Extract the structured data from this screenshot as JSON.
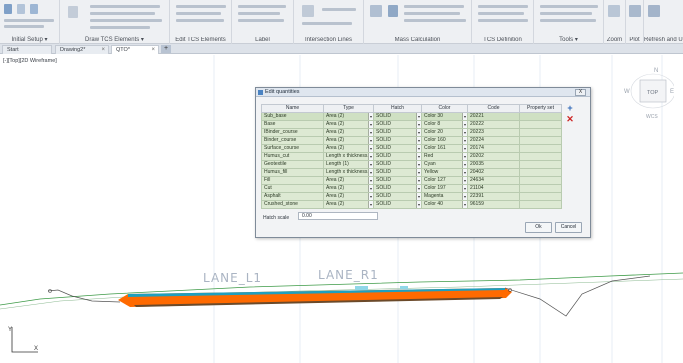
{
  "ribbon": {
    "groups": [
      {
        "title": "Initial Setup ▾"
      },
      {
        "title": "Draw TCS Elements ▾"
      },
      {
        "title": "Edit TCS Elements"
      },
      {
        "title": "Label"
      },
      {
        "title": "Intersection Lines"
      },
      {
        "title": "Mass Calculation"
      },
      {
        "title": "TCS Definition"
      },
      {
        "title": "Tools ▾"
      },
      {
        "title": "Zoom"
      },
      {
        "title": "Plot"
      },
      {
        "title": "Refresh and Undo"
      }
    ]
  },
  "tabs": [
    {
      "label": "Start"
    },
    {
      "label": "Drawing2*"
    },
    {
      "label": "QTO*"
    }
  ],
  "canvas": {
    "view_label": "[-][Top][2D Wireframe]",
    "viewcube": {
      "top": "TOP",
      "north": "N",
      "west": "W",
      "east": "E",
      "wcs": "WCS"
    },
    "lane_left": "LANE_L1",
    "lane_right": "LANE_R1",
    "ucs_y": "Y",
    "ucs_x": "X"
  },
  "dialog": {
    "title": "Edit quantities",
    "close": "X",
    "columns": [
      "Name",
      "Type",
      "Hatch",
      "Color",
      "Code",
      "Property set"
    ],
    "rows": [
      {
        "name": "Sub_base",
        "type": "Area (2)",
        "hatch": "SOLID",
        "color": "Color 30",
        "code": "20221",
        "pset": ""
      },
      {
        "name": "Base",
        "type": "Area (2)",
        "hatch": "SOLID",
        "color": "Color 8",
        "code": "20222",
        "pset": ""
      },
      {
        "name": "IBinder_course",
        "type": "Area (2)",
        "hatch": "SOLID",
        "color": "Color 20",
        "code": "20223",
        "pset": ""
      },
      {
        "name": "Binder_course",
        "type": "Area (2)",
        "hatch": "SOLID",
        "color": "Color 160",
        "code": "20224",
        "pset": ""
      },
      {
        "name": "Surface_course",
        "type": "Area (2)",
        "hatch": "SOLID",
        "color": "Color 161",
        "code": "20174",
        "pset": ""
      },
      {
        "name": "Humus_cut",
        "type": "Length x thickness...",
        "hatch": "SOLID",
        "color": "Red",
        "code": "20202",
        "pset": ""
      },
      {
        "name": "Geotextile",
        "type": "Length (1)",
        "hatch": "SOLID",
        "color": "Cyan",
        "code": "20035",
        "pset": ""
      },
      {
        "name": "Humus_fill",
        "type": "Length x thickness...",
        "hatch": "SOLID",
        "color": "Yellow",
        "code": "20402",
        "pset": ""
      },
      {
        "name": "Fill",
        "type": "Area (2)",
        "hatch": "SOLID",
        "color": "Color 127",
        "code": "24634",
        "pset": ""
      },
      {
        "name": "Cut",
        "type": "Area (2)",
        "hatch": "SOLID",
        "color": "Color 197",
        "code": "21104",
        "pset": ""
      },
      {
        "name": "Asphalt",
        "type": "Area (2)",
        "hatch": "SOLID",
        "color": "Magenta",
        "code": "22391",
        "pset": ""
      },
      {
        "name": "Crushed_stone",
        "type": "Area (2)",
        "hatch": "SOLID",
        "color": "Color 40",
        "code": "96159",
        "pset": ""
      }
    ],
    "add_icon": "+",
    "delete_icon": "✕",
    "hatch_scale_label": "Hatch scale",
    "hatch_scale_value": "0.00",
    "ok_label": "Ok",
    "cancel_label": "Cancel"
  },
  "colors": {
    "row_bg": "#dde9d3",
    "asphalt": "#ff6a00",
    "subgrade": "#6b4a2a",
    "surface": "#1f9fbf"
  }
}
